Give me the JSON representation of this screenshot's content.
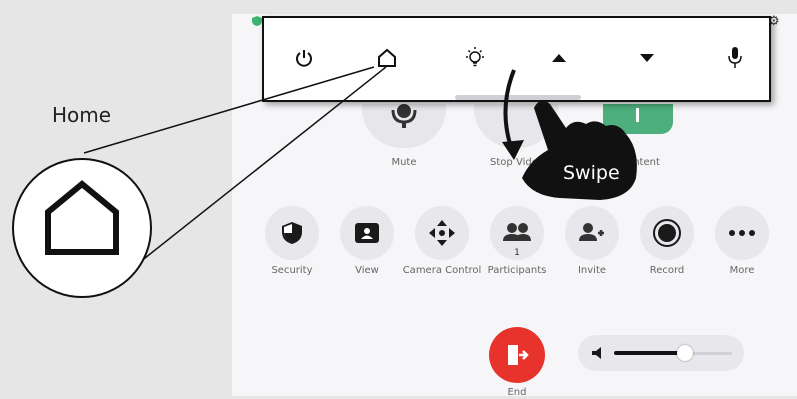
{
  "controls": {
    "mute": "Mute",
    "stop_video": "Stop Video",
    "content": "Content",
    "security": "Security",
    "view": "View",
    "camera_control": "Camera Control",
    "participants": "Participants",
    "participants_count": "1",
    "invite": "Invite",
    "record": "Record",
    "more": "More",
    "end": "End"
  },
  "volume": {
    "level": 0.6
  },
  "toolbar": {
    "items": [
      "power-icon",
      "home-icon",
      "lightbulb-icon",
      "up-arrow-icon",
      "down-arrow-icon",
      "microphone-icon"
    ]
  },
  "annotations": {
    "home_label": "Home",
    "swipe_label": "Swipe"
  },
  "colors": {
    "end_button": "#e8322c",
    "content_button": "#4caf7d",
    "background": "#f6f6f8"
  }
}
